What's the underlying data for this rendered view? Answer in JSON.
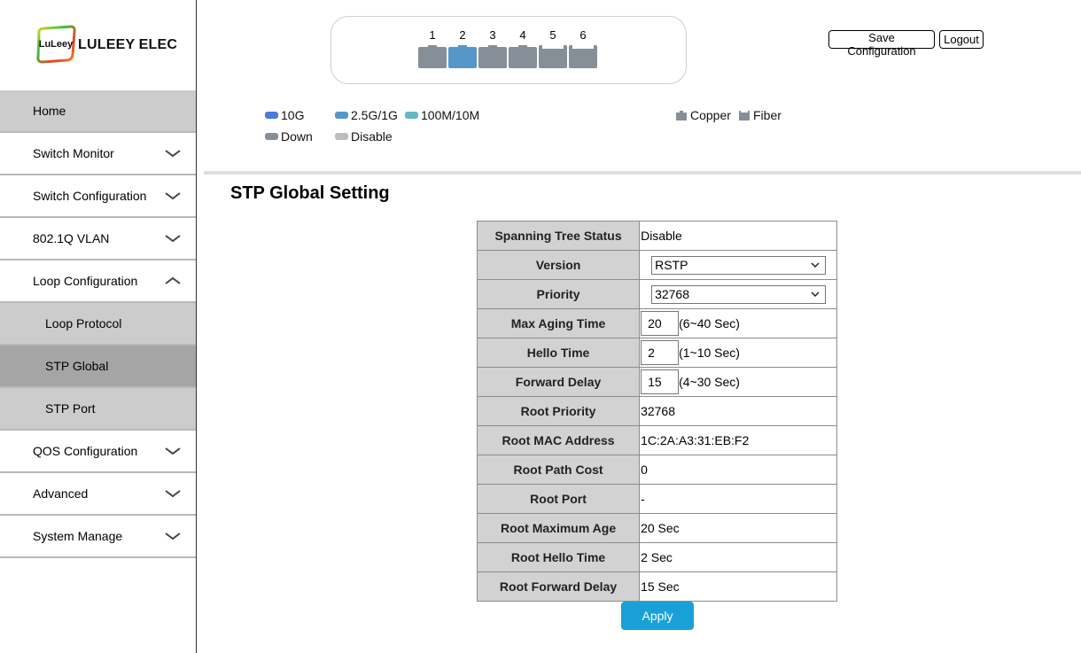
{
  "brand": {
    "badge_text": "LuLeey",
    "name": "LULEEY ELEC"
  },
  "sidebar": {
    "items": [
      {
        "label": "Home"
      },
      {
        "label": "Switch Monitor"
      },
      {
        "label": "Switch Configuration"
      },
      {
        "label": "802.1Q VLAN"
      },
      {
        "label": "Loop Configuration"
      },
      {
        "label": "Loop Protocol"
      },
      {
        "label": "STP Global"
      },
      {
        "label": "STP Port"
      },
      {
        "label": "QOS Configuration"
      },
      {
        "label": "Advanced"
      },
      {
        "label": "System Manage"
      }
    ]
  },
  "ports": [
    {
      "number": "1",
      "status": "down",
      "color": "#868e98"
    },
    {
      "number": "2",
      "status": "2.5G/1G",
      "color": "#5597c8"
    },
    {
      "number": "3",
      "status": "down",
      "color": "#868e98"
    },
    {
      "number": "4",
      "status": "down",
      "color": "#868e98"
    },
    {
      "number": "5",
      "status": "down",
      "color": "#868e98"
    },
    {
      "number": "6",
      "status": "down",
      "color": "#868e98"
    }
  ],
  "header": {
    "save_label": "Save Configuration",
    "logout_label": "Logout"
  },
  "legend": {
    "speed_10g": {
      "label": "10G",
      "color": "#4d79d8"
    },
    "speed_25g": {
      "label": "2.5G/1G",
      "color": "#5597c8"
    },
    "speed_100m": {
      "label": "100M/10M",
      "color": "#62b9c4"
    },
    "down": {
      "label": "Down",
      "color": "#868e98"
    },
    "disable": {
      "label": "Disable",
      "color": "#bdbdbd"
    },
    "copper": {
      "label": "Copper"
    },
    "fiber": {
      "label": "Fiber"
    }
  },
  "page_title": "STP Global Setting",
  "form": {
    "spanning_tree_status": {
      "label": "Spanning Tree Status",
      "value": "Disable"
    },
    "version": {
      "label": "Version",
      "value": "RSTP"
    },
    "priority": {
      "label": "Priority",
      "value": "32768"
    },
    "max_aging_time": {
      "label": "Max Aging Time",
      "value": "20",
      "hint": "(6~40 Sec)"
    },
    "hello_time": {
      "label": "Hello Time",
      "value": "2",
      "hint": "(1~10 Sec)"
    },
    "forward_delay": {
      "label": "Forward Delay",
      "value": "15",
      "hint": "(4~30 Sec)"
    },
    "root_priority": {
      "label": "Root Priority",
      "value": "32768"
    },
    "root_mac": {
      "label": "Root MAC Address",
      "value": "1C:2A:A3:31:EB:F2"
    },
    "root_path_cost": {
      "label": "Root Path Cost",
      "value": "0"
    },
    "root_port": {
      "label": "Root Port",
      "value": "-"
    },
    "root_max_age": {
      "label": "Root Maximum Age",
      "value": "20 Sec"
    },
    "root_hello_time": {
      "label": "Root Hello Time",
      "value": "2 Sec"
    },
    "root_forward_delay": {
      "label": "Root Forward Delay",
      "value": "15 Sec"
    }
  },
  "apply_label": "Apply",
  "colors": {
    "accent": "#1aa0d8",
    "sidebar_gray": "#cccccc",
    "sidebar_active": "#a5a5a5"
  }
}
